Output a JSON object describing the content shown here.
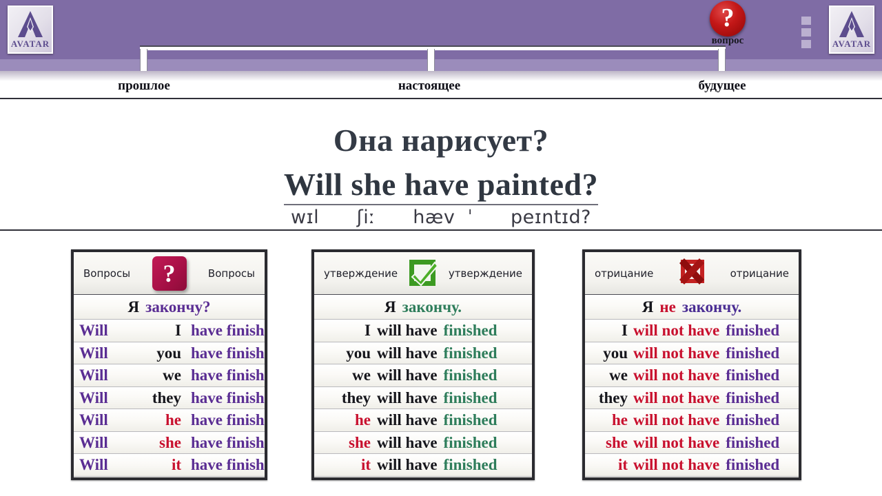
{
  "header": {
    "logo_left": {
      "name": "AVATAR",
      "word": "AVATAR"
    },
    "logo_right": {
      "name": "AVATAR",
      "word": "AVATAR"
    },
    "question_badge": {
      "glyph": "?",
      "label": "вопрос"
    },
    "menu_icon": "kebab-menu-icon",
    "timeline": {
      "labels": [
        "прошлое",
        "настоящее",
        "будущее"
      ]
    }
  },
  "sentence": {
    "russian": "Она нарисует?",
    "english": "Will she have painted?",
    "phonetic": "wɪl      ʃiː      hæv  ˈ      peɪntɪd?"
  },
  "tables": [
    {
      "id": "questions",
      "head_left": "Вопросы",
      "head_right": "Вопросы",
      "icon": "question-mark-icon",
      "icon_glyph": "?",
      "ru_prefix": "Я",
      "ru_rest": "закончу?",
      "rows": [
        {
          "aux": "Will",
          "pronoun": "I",
          "rest": "have finished",
          "pronoun_color": "dark"
        },
        {
          "aux": "Will",
          "pronoun": "you",
          "rest": "have finished",
          "pronoun_color": "dark"
        },
        {
          "aux": "Will",
          "pronoun": "we",
          "rest": "have finished",
          "pronoun_color": "dark"
        },
        {
          "aux": "Will",
          "pronoun": "they",
          "rest": "have finished",
          "pronoun_color": "dark"
        },
        {
          "aux": "Will",
          "pronoun": "he",
          "rest": "have finished",
          "pronoun_color": "red"
        },
        {
          "aux": "Will",
          "pronoun": "she",
          "rest": "have finished",
          "pronoun_color": "red"
        },
        {
          "aux": "Will",
          "pronoun": "it",
          "rest": "have finished",
          "pronoun_color": "red"
        }
      ]
    },
    {
      "id": "affirmative",
      "head_left": "утверждение",
      "head_right": "утверждение",
      "icon": "green-check-icon",
      "ru_prefix": "Я",
      "ru_rest": "закончу.",
      "rows": [
        {
          "pronoun": "I",
          "mid": "will have",
          "verb": "finished",
          "pronoun_color": "dark"
        },
        {
          "pronoun": "you",
          "mid": "will have",
          "verb": "finished",
          "pronoun_color": "dark"
        },
        {
          "pronoun": "we",
          "mid": "will have",
          "verb": "finished",
          "pronoun_color": "dark"
        },
        {
          "pronoun": "they",
          "mid": "will have",
          "verb": "finished",
          "pronoun_color": "dark"
        },
        {
          "pronoun": "he",
          "mid": "will have",
          "verb": "finished",
          "pronoun_color": "red"
        },
        {
          "pronoun": "she",
          "mid": "will have",
          "verb": "finished",
          "pronoun_color": "red"
        },
        {
          "pronoun": "it",
          "mid": "will have",
          "verb": "finished",
          "pronoun_color": "red"
        }
      ]
    },
    {
      "id": "negative",
      "head_left": "отрицание",
      "head_right": "отрицание",
      "icon": "red-cross-icon",
      "ru_prefix": "Я",
      "ru_neg": "не",
      "ru_rest": "закончу.",
      "rows": [
        {
          "pronoun": "I",
          "mid": "will not have",
          "verb": "finished",
          "pronoun_color": "dark"
        },
        {
          "pronoun": "you",
          "mid": "will not have",
          "verb": "finished",
          "pronoun_color": "dark"
        },
        {
          "pronoun": "we",
          "mid": "will not have",
          "verb": "finished",
          "pronoun_color": "dark"
        },
        {
          "pronoun": "they",
          "mid": "will not have",
          "verb": "finished",
          "pronoun_color": "dark"
        },
        {
          "pronoun": "he",
          "mid": "will not have",
          "verb": "finished",
          "pronoun_color": "red"
        },
        {
          "pronoun": "she",
          "mid": "will not have",
          "verb": "finished",
          "pronoun_color": "red"
        },
        {
          "pronoun": "it",
          "mid": "will not have",
          "verb": "finished",
          "pronoun_color": "red"
        }
      ]
    }
  ],
  "colors": {
    "header_purple": "#7f6ca5",
    "header_band": "#9b8cbb",
    "accent_purple": "#5a2d93",
    "accent_red": "#c8102e",
    "accent_green": "#2e7d5b",
    "badge_red": "#c41818",
    "badge_crimson": "#a50f45"
  }
}
